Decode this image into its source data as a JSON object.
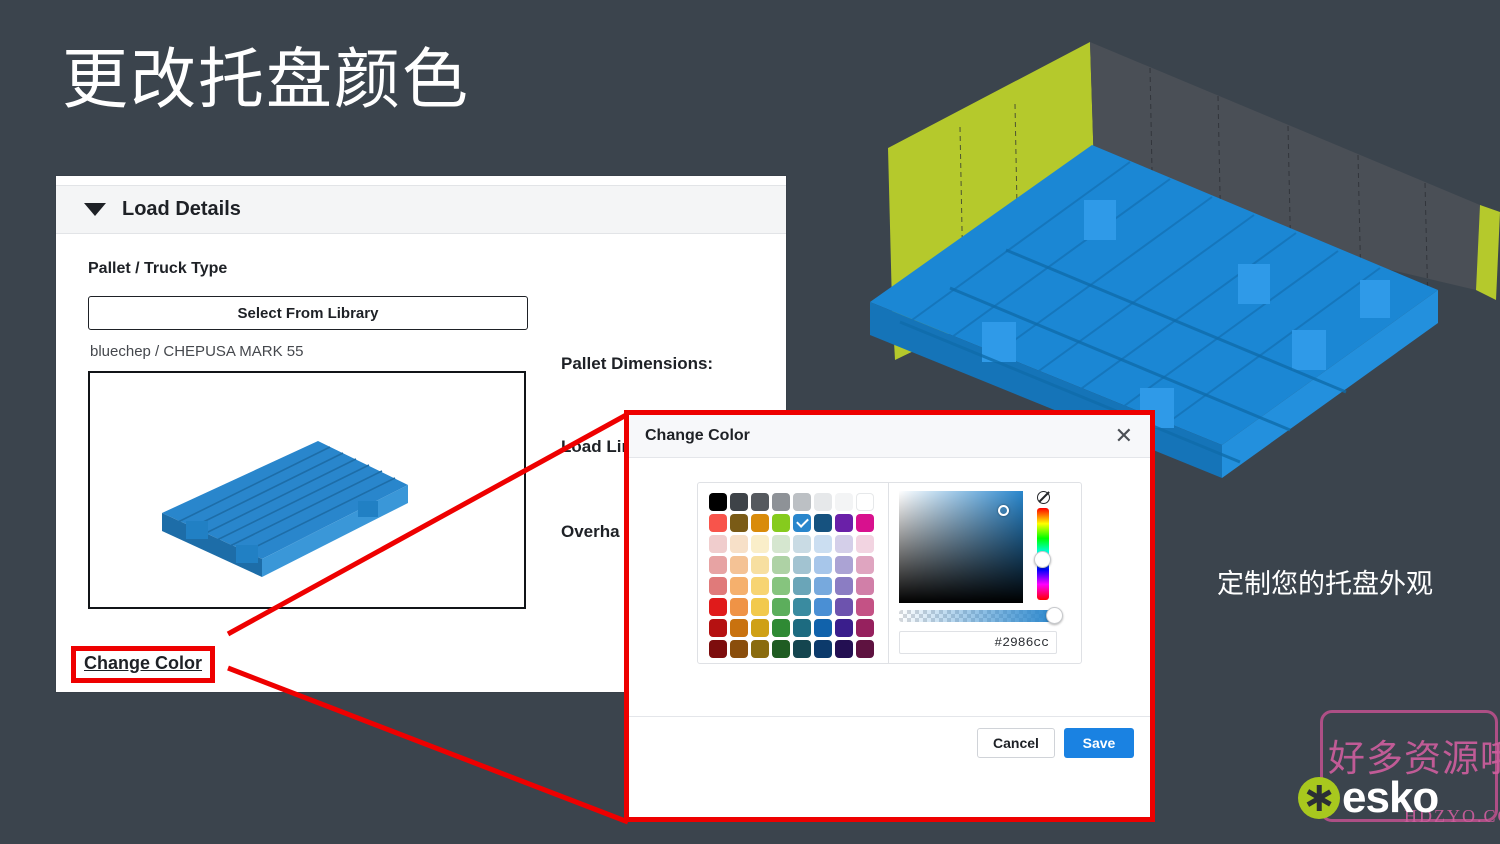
{
  "slide": {
    "title": "更改托盘颜色",
    "caption": "定制您的托盘外观",
    "background_color": "#3b444d"
  },
  "panel": {
    "header_title": "Load Details",
    "caret_icon": "triangle-down-icon",
    "section_label": "Pallet / Truck Type",
    "select_library_button": "Select From Library",
    "pallet_name": "bluechep / CHEPUSA MARK 55",
    "change_color_link": "Change Color",
    "right_labels": [
      "Pallet Dimensions:",
      "Load Limits:",
      "Overhang:"
    ],
    "overhang_visible_text": "Overha"
  },
  "dialog": {
    "title": "Change Color",
    "close_icon": "close-icon",
    "no_color_icon": "no-color-icon",
    "hex_value": "#2986cc",
    "selected_swatch_index": 12,
    "cancel_label": "Cancel",
    "save_label": "Save",
    "save_color": "#1a82e2",
    "swatches": [
      "#000000",
      "#3e4348",
      "#55595e",
      "#8e9297",
      "#bcc0c4",
      "#e6e8ea",
      "#f3f4f5",
      "#ffffff",
      "#f8544b",
      "#7a5b16",
      "#d98b0a",
      "#86cb1d",
      "#2986cc",
      "#16527f",
      "#6a20a8",
      "#d8118e",
      "#f0cdcd",
      "#f7e0c8",
      "#faeec9",
      "#d5e6cf",
      "#c9dbe4",
      "#cbdef1",
      "#d4cfe9",
      "#f2d4e1",
      "#e7a3a3",
      "#f4c295",
      "#f7dfa0",
      "#aed2a5",
      "#a2c3d1",
      "#a7c6ea",
      "#aba3d4",
      "#dfa5c0",
      "#e07a7a",
      "#f5b06d",
      "#f7d472",
      "#86c47e",
      "#6aa5b8",
      "#77a9dd",
      "#8b7dc3",
      "#d17fa8",
      "#e01b1b",
      "#ef9346",
      "#f2c94c",
      "#5cae5c",
      "#3a8ba0",
      "#4a8fd4",
      "#6d53ae",
      "#c45285",
      "#b51111",
      "#c9720f",
      "#cfa015",
      "#2f8a34",
      "#1d6b80",
      "#1162ab",
      "#3a1e8c",
      "#96215e",
      "#7d0d0d",
      "#8a4e0c",
      "#8a6b0e",
      "#1f5c22",
      "#14454f",
      "#0c3a6b",
      "#230f52",
      "#5e1240"
    ]
  },
  "render": {
    "pallet_color": "#1b87d4",
    "box_side_color": "#b5c92c",
    "box_front_color": "#4a4f56",
    "pallet_thumb_color": "#2986cc"
  },
  "watermark": {
    "chinese": "好多资源哦",
    "domain": "HDZYO.COM",
    "brand": "esko",
    "brand_color": "#a8c81e",
    "frame_color": "#c2518f"
  }
}
